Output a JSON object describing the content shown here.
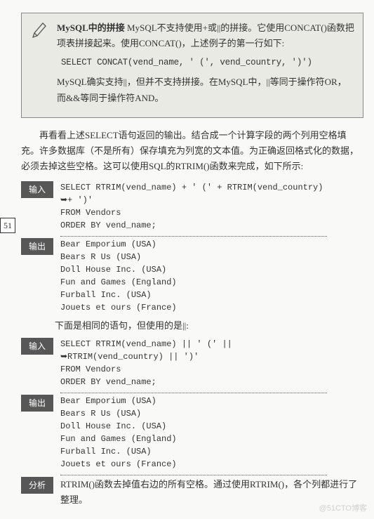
{
  "note": {
    "title": "MySQL中的拼接",
    "para1_rest": "  MySQL不支持使用+或||的拼接。它使用CONCAT()函数把项表拼接起来。使用CONCAT()，上述例子的第一行如下:",
    "code": "SELECT CONCAT(vend_name, ' (', vend_country, ')')",
    "para2": "MySQL确实支持||，但并不支持拼接。在MySQL中，||等同于操作符OR，而&&等同于操作符AND。"
  },
  "body": {
    "para": "再看看上述SELECT语句返回的输出。结合成一个计算字段的两个列用空格填充。许多数据库（不是所有）保存填充为列宽的文本值。为正确返回格式化的数据，必须去掉这些空格。这可以使用SQL的RTRIM()函数来完成，如下所示:"
  },
  "page_num": "51",
  "labels": {
    "input": "输入",
    "output": "输出",
    "analysis": "分析"
  },
  "input1": {
    "l1": "SELECT RTRIM(vend_name) + ' (' + RTRIM(vend_country)",
    "l2": "➥+ ')'",
    "l3": "FROM Vendors",
    "l4": "ORDER BY vend_name;"
  },
  "output1": {
    "r1": "Bear Emporium (USA)",
    "r2": "Bears R Us (USA)",
    "r3": "Doll House Inc. (USA)",
    "r4": "Fun and Games (England)",
    "r5": "Furball Inc. (USA)",
    "r6": "Jouets et ours (France)"
  },
  "mid_text": "下面是相同的语句，但使用的是||:",
  "input2": {
    "l1": "SELECT RTRIM(vend_name) || ' (' ||",
    "l2": "➥RTRIM(vend_country) || ')'",
    "l3": "FROM Vendors",
    "l4": "ORDER BY vend_name;"
  },
  "output2": {
    "r1": "Bear Emporium (USA)",
    "r2": "Bears R Us (USA)",
    "r3": "Doll House Inc. (USA)",
    "r4": "Fun and Games (England)",
    "r5": "Furball Inc. (USA)",
    "r6": "Jouets et ours (France)"
  },
  "analysis": "RTRIM()函数去掉值右边的所有空格。通过使用RTRIM()，各个列都进行了整理。",
  "watermark": "@51CTO博客"
}
